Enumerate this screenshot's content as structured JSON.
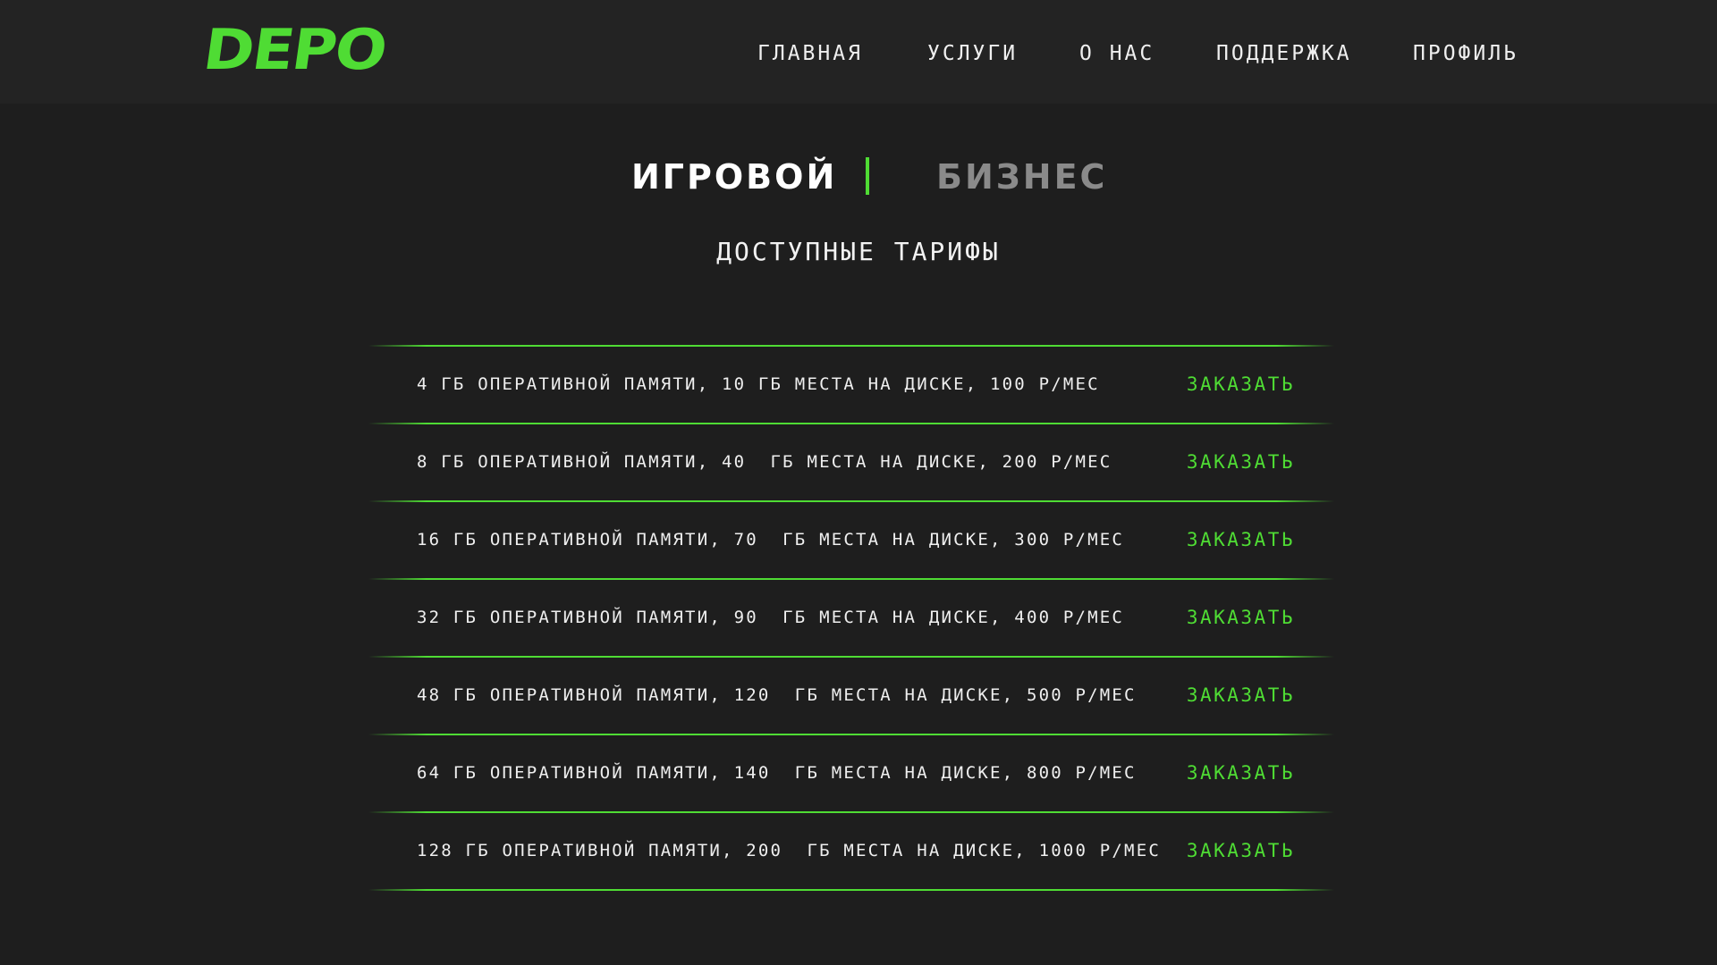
{
  "header": {
    "logo_text": "DEPO",
    "nav": [
      {
        "label": "ГЛАВНАЯ"
      },
      {
        "label": "УСЛУГИ"
      },
      {
        "label": "О НАС"
      },
      {
        "label": "ПОДДЕРЖКА"
      },
      {
        "label": "ПРОФИЛЬ"
      }
    ]
  },
  "tabs": [
    {
      "label": "ИГРОВОЙ",
      "active": true
    },
    {
      "label": "БИЗНЕС",
      "active": false
    }
  ],
  "section_title": "ДОСТУПНЫЕ ТАРИФЫ",
  "plans": [
    {
      "text": "4 ГБ ОПЕРАТИВНОЙ ПАМЯТИ, 10 ГБ МЕСТА НА ДИСКЕ, 100 Р/МЕС",
      "button": "ЗАКАЗАТЬ"
    },
    {
      "text": "8 ГБ ОПЕРАТИВНОЙ ПАМЯТИ, 40  ГБ МЕСТА НА ДИСКЕ, 200 Р/МЕС",
      "button": "ЗАКАЗАТЬ"
    },
    {
      "text": "16 ГБ ОПЕРАТИВНОЙ ПАМЯТИ, 70  ГБ МЕСТА НА ДИСКЕ, 300 Р/МЕС",
      "button": "ЗАКАЗАТЬ"
    },
    {
      "text": "32 ГБ ОПЕРАТИВНОЙ ПАМЯТИ, 90  ГБ МЕСТА НА ДИСКЕ, 400 Р/МЕС",
      "button": "ЗАКАЗАТЬ"
    },
    {
      "text": "48 ГБ ОПЕРАТИВНОЙ ПАМЯТИ, 120  ГБ МЕСТА НА ДИСКЕ, 500 Р/МЕС",
      "button": "ЗАКАЗАТЬ"
    },
    {
      "text": "64 ГБ ОПЕРАТИВНОЙ ПАМЯТИ, 140  ГБ МЕСТА НА ДИСКЕ, 800 Р/МЕС",
      "button": "ЗАКАЗАТЬ"
    },
    {
      "text": "128 ГБ ОПЕРАТИВНОЙ ПАМЯТИ, 200  ГБ МЕСТА НА ДИСКЕ, 1000 Р/МЕС",
      "button": "ЗАКАЗАТЬ"
    }
  ],
  "colors": {
    "accent": "#4fdc34",
    "background": "#1e1e1e",
    "header_background": "#232323",
    "inactive_tab": "#8a8a8a"
  }
}
